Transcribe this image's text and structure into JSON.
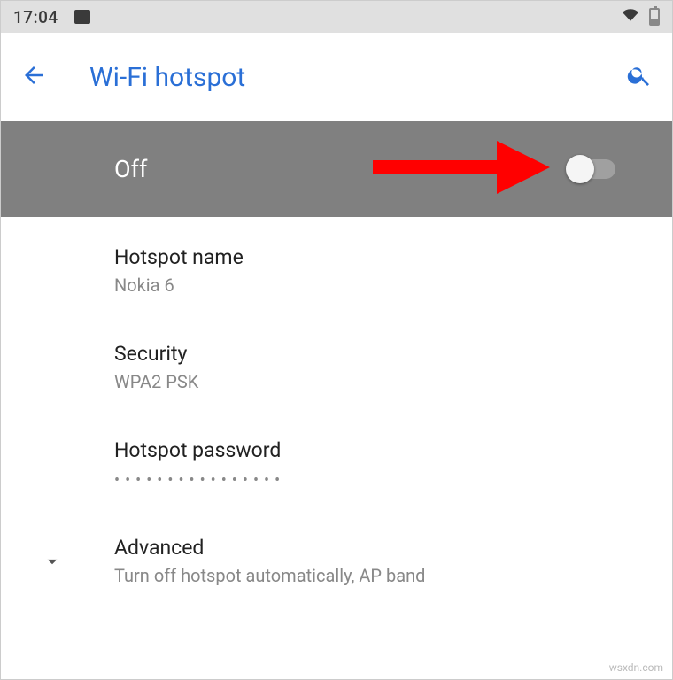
{
  "status_bar": {
    "time": "17:04"
  },
  "app_bar": {
    "title": "Wi-Fi hotspot"
  },
  "toggle": {
    "state_label": "Off"
  },
  "items": {
    "hotspot_name": {
      "title": "Hotspot name",
      "value": "Nokia 6"
    },
    "security": {
      "title": "Security",
      "value": "WPA2 PSK"
    },
    "password": {
      "title": "Hotspot password",
      "masked": "••••••••••••••••"
    },
    "advanced": {
      "title": "Advanced",
      "summary": "Turn off hotspot automatically, AP band"
    }
  },
  "watermark": "wsxdn.com",
  "colors": {
    "accent": "#2a6fd6",
    "toggle_bg": "#808080",
    "annotation": "#ff0000"
  }
}
